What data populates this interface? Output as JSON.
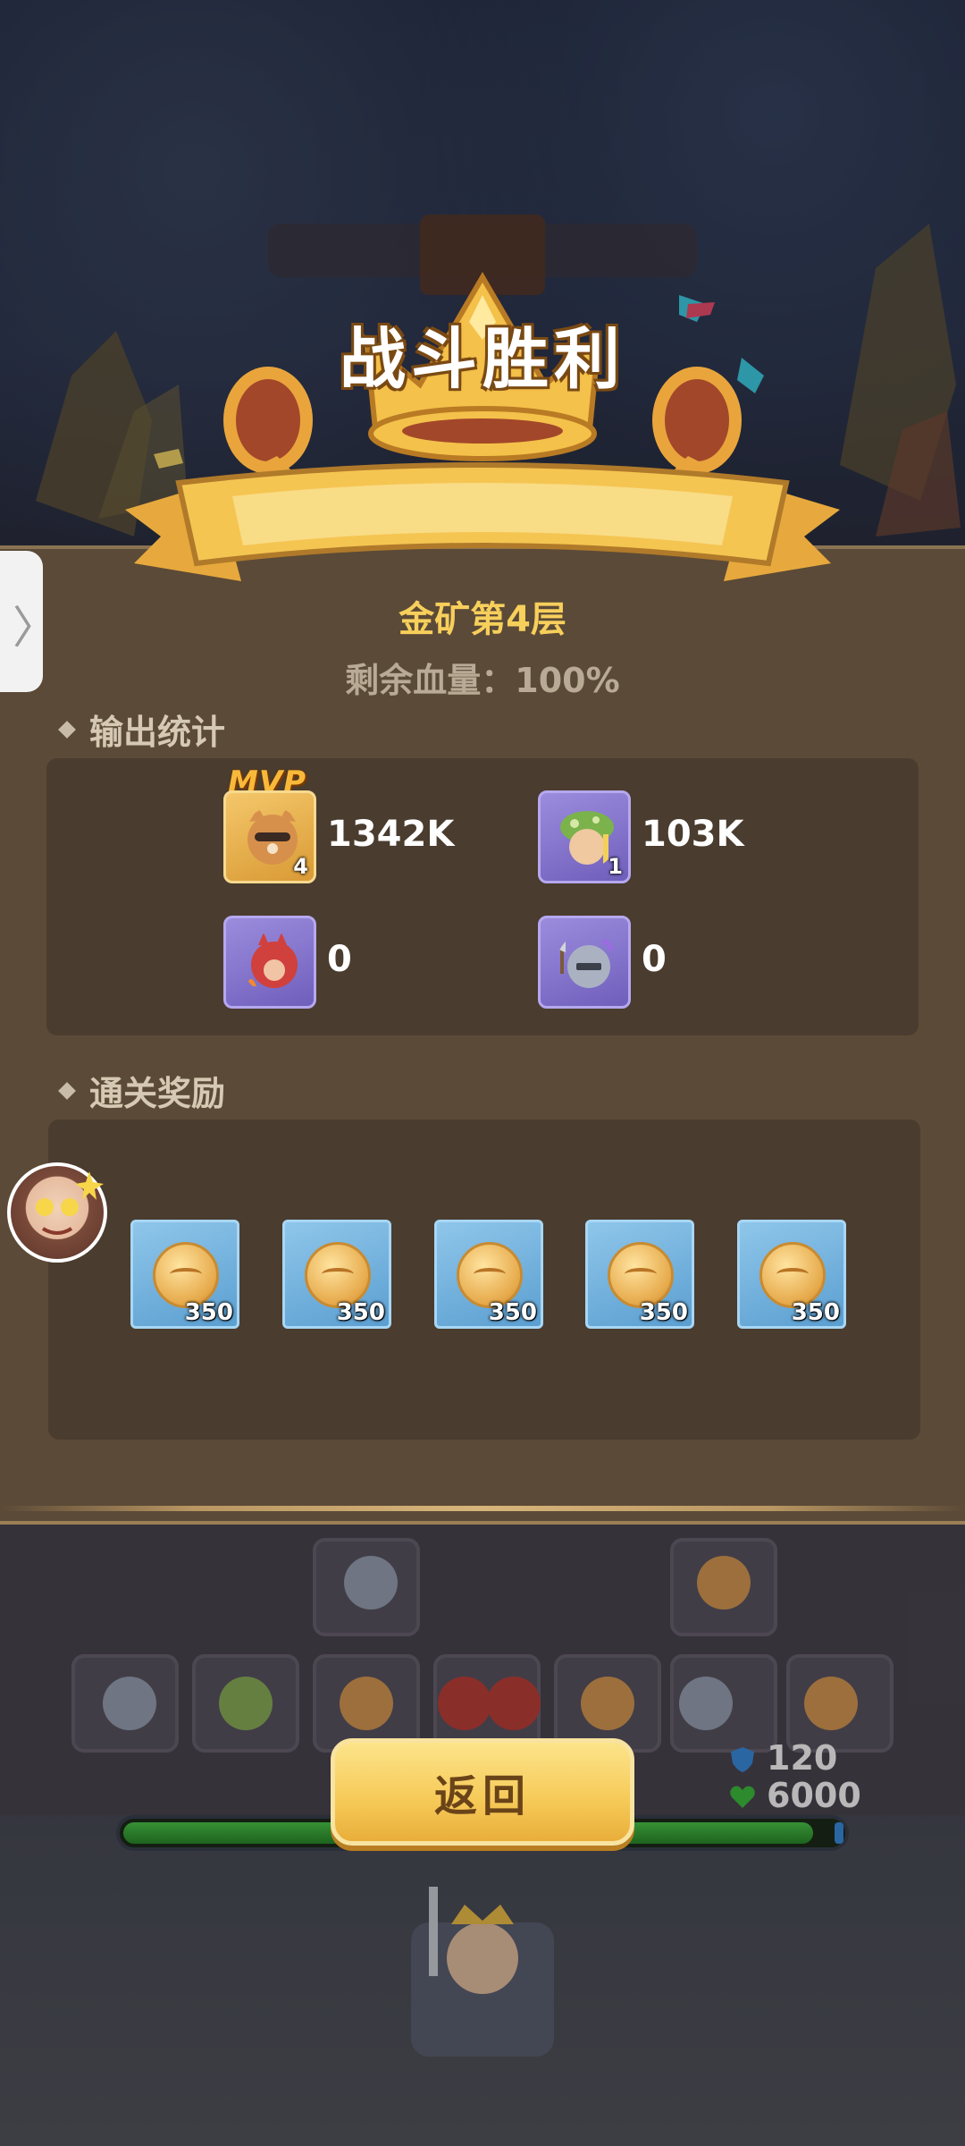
{
  "banner": {
    "title": "战斗胜利"
  },
  "result": {
    "level": "金矿第4层",
    "remaining_hp": "剩余血量：100%"
  },
  "output_stats": {
    "title": "输出统计",
    "mvp_label": "MVP",
    "heroes": [
      {
        "name": "raccoon-gunner",
        "level": "4",
        "damage": "1342K",
        "frame": "gold",
        "mvp": true
      },
      {
        "name": "mushroom-mage",
        "level": "1",
        "damage": "103K",
        "frame": "purple",
        "mvp": false
      },
      {
        "name": "fire-imp",
        "level": "",
        "damage": "0",
        "frame": "purple",
        "mvp": false
      },
      {
        "name": "axe-knight",
        "level": "",
        "damage": "0",
        "frame": "purple",
        "mvp": false
      }
    ]
  },
  "rewards": {
    "title": "通关奖励",
    "items": [
      {
        "icon": "gold-coin-icon",
        "count": "350"
      },
      {
        "icon": "gold-coin-icon",
        "count": "350"
      },
      {
        "icon": "gold-coin-icon",
        "count": "350"
      },
      {
        "icon": "gold-coin-icon",
        "count": "350"
      },
      {
        "icon": "gold-coin-icon",
        "count": "350"
      }
    ]
  },
  "base_stats": {
    "shield": "120",
    "health": "6000",
    "health_fill": 0.96
  },
  "buttons": {
    "return_label": "返回"
  },
  "side_handle": {
    "glyph": "〉"
  },
  "colors": {
    "accent_gold": "#f7cf5b",
    "panel": "#5b4a37",
    "reward_tile": "#8fc6ea",
    "hero_purple": "#9c8cdd"
  }
}
